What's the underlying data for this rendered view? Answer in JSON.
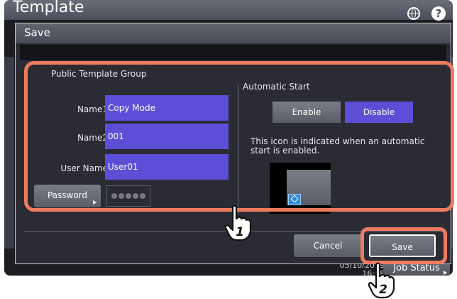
{
  "window": {
    "title": "Template",
    "globe_icon": "globe-icon",
    "help_icon": "help-icon",
    "help_glyph": "?",
    "footer_date": "05/10/2019",
    "footer_time": "16:08",
    "job_status_label": "Job Status"
  },
  "dialog": {
    "title": "Save",
    "group_title": "Public Template Group",
    "fields": [
      {
        "label": "Name1",
        "value": "Copy Mode"
      },
      {
        "label": "Name2",
        "value": "001"
      },
      {
        "label": "User Name",
        "value": "User01"
      }
    ],
    "password_label": "Password",
    "automatic_start": {
      "title": "Automatic Start",
      "enable_label": "Enable",
      "disable_label": "Disable",
      "selected": "Disable",
      "description": "This icon is indicated when an automatic start is enabled."
    },
    "cancel_label": "Cancel",
    "save_label": "Save"
  },
  "callouts": {
    "step1": "1",
    "step2": "2",
    "accent": "#ef7b5f"
  },
  "colors": {
    "selected": "#5a4fd6",
    "background": "#1c1d22"
  }
}
